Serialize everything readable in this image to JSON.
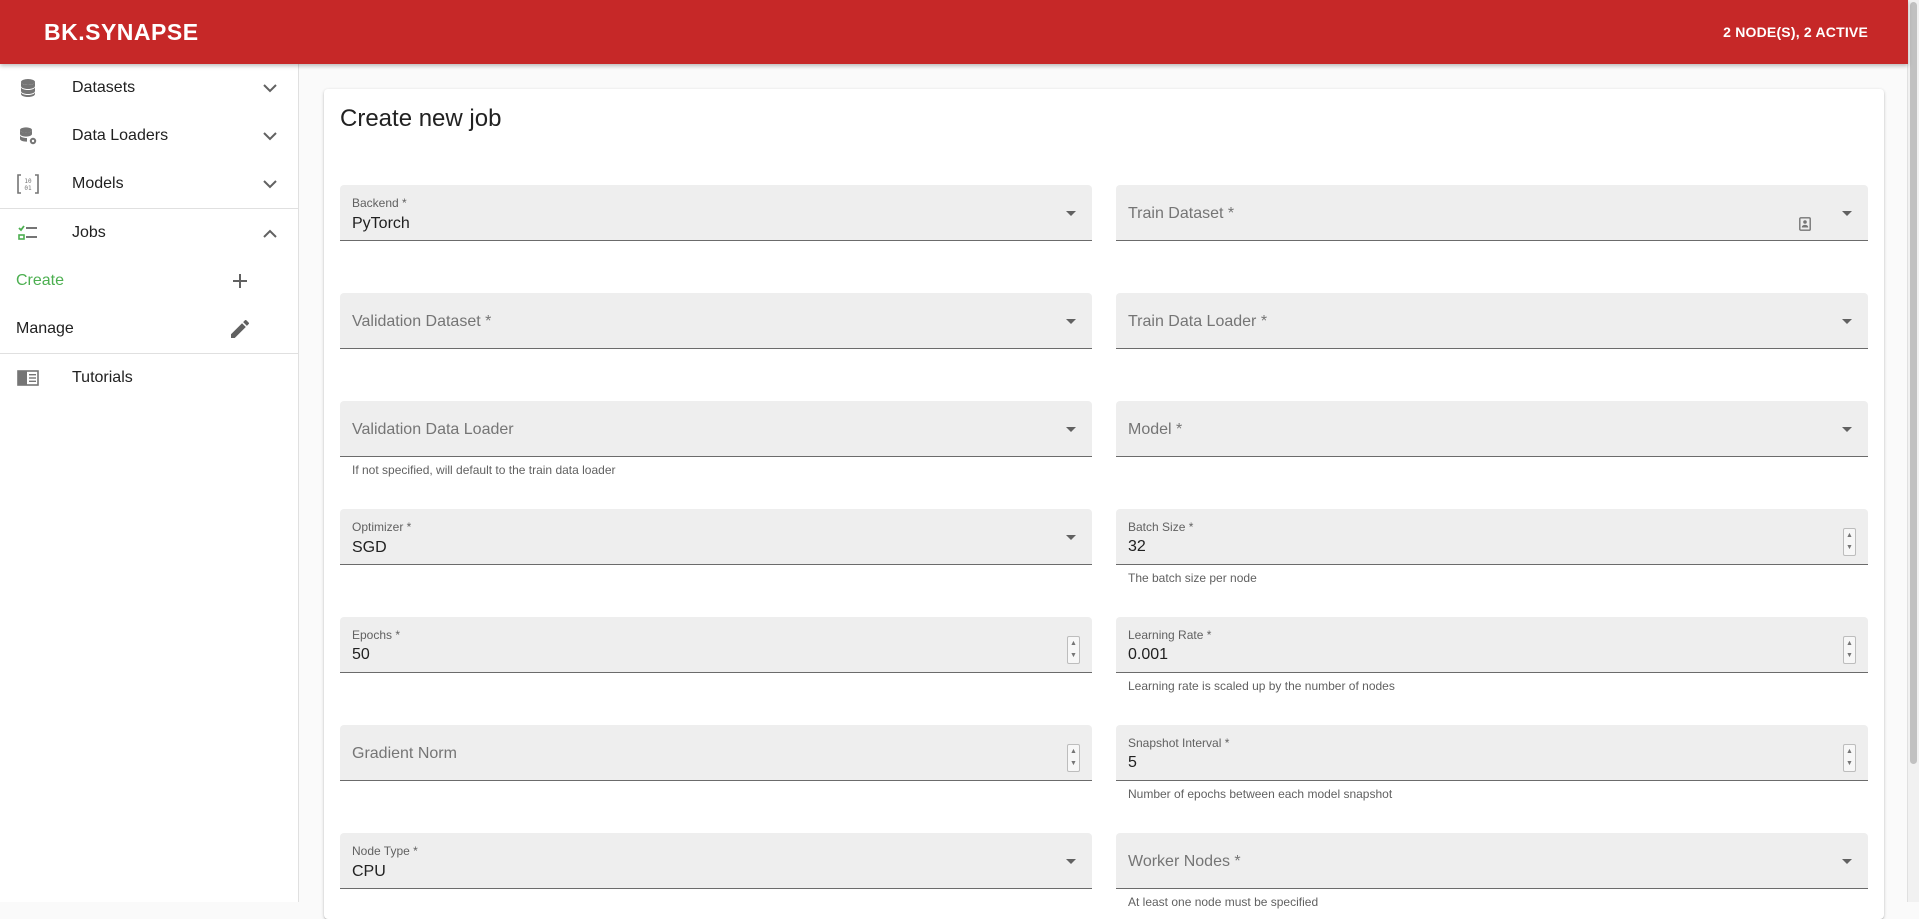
{
  "header": {
    "brand": "BK.SYNAPSE",
    "status": "2 NODE(S), 2 ACTIVE",
    "color": "#c62828"
  },
  "sidebar": {
    "items": [
      {
        "label": "Datasets",
        "icon": "database-icon",
        "expanded": false
      },
      {
        "label": "Data Loaders",
        "icon": "database-settings-icon",
        "expanded": false
      },
      {
        "label": "Models",
        "icon": "binary-matrix-icon",
        "expanded": false
      },
      {
        "label": "Jobs",
        "icon": "checklist-icon",
        "expanded": true
      }
    ],
    "jobs_sub": {
      "create_label": "Create",
      "manage_label": "Manage"
    },
    "tutorials_label": "Tutorials",
    "active_color": "#4caf50"
  },
  "form": {
    "title": "Create new job",
    "backend": {
      "label": "Backend *",
      "value": "PyTorch"
    },
    "train_dataset": {
      "label": "Train Dataset *"
    },
    "validation_dataset": {
      "label": "Validation Dataset *"
    },
    "train_data_loader": {
      "label": "Train Data Loader *"
    },
    "validation_data_loader": {
      "label": "Validation Data Loader",
      "hint": "If not specified, will default to the train data loader"
    },
    "model": {
      "label": "Model *"
    },
    "optimizer": {
      "label": "Optimizer *",
      "value": "SGD"
    },
    "batch_size": {
      "label": "Batch Size *",
      "value": "32",
      "hint": "The batch size per node"
    },
    "epochs": {
      "label": "Epochs *",
      "value": "50"
    },
    "learning_rate": {
      "label": "Learning Rate *",
      "value": "0.001",
      "hint": "Learning rate is scaled up by the number of nodes"
    },
    "gradient_norm": {
      "label": "Gradient Norm"
    },
    "snapshot_interval": {
      "label": "Snapshot Interval *",
      "value": "5",
      "hint": "Number of epochs between each model snapshot"
    },
    "node_type": {
      "label": "Node Type *",
      "value": "CPU"
    },
    "worker_nodes": {
      "label": "Worker Nodes *",
      "hint": "At least one node must be specified"
    }
  }
}
